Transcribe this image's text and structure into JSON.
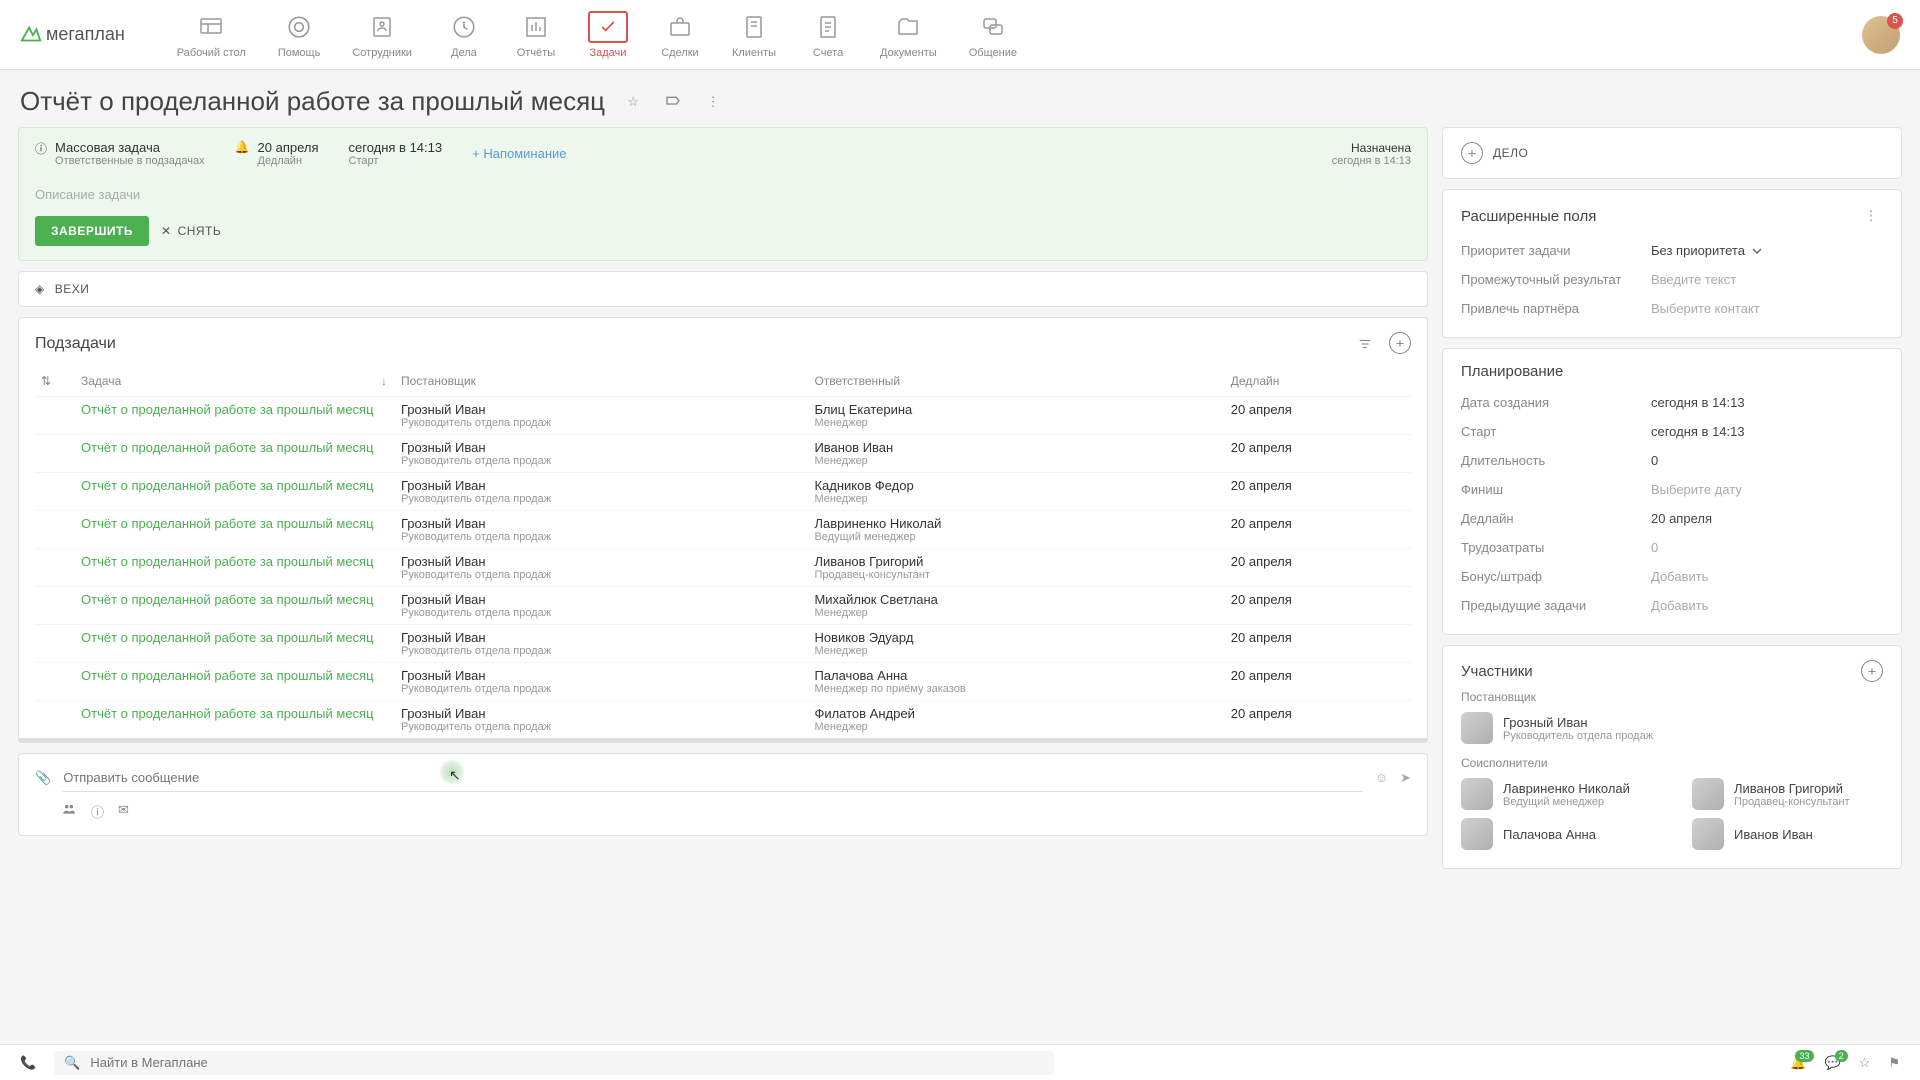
{
  "header": {
    "logo": "мегаплан",
    "avatar_badge": "5",
    "nav": [
      {
        "label": "Рабочий стол",
        "name": "nav-desktop"
      },
      {
        "label": "Помощь",
        "name": "nav-help"
      },
      {
        "label": "Сотрудники",
        "name": "nav-staff"
      },
      {
        "label": "Дела",
        "name": "nav-affairs"
      },
      {
        "label": "Отчёты",
        "name": "nav-reports"
      },
      {
        "label": "Задачи",
        "name": "nav-tasks",
        "active": true
      },
      {
        "label": "Сделки",
        "name": "nav-deals"
      },
      {
        "label": "Клиенты",
        "name": "nav-clients"
      },
      {
        "label": "Счета",
        "name": "nav-invoices"
      },
      {
        "label": "Документы",
        "name": "nav-docs"
      },
      {
        "label": "Общение",
        "name": "nav-chat"
      }
    ]
  },
  "title": "Отчёт о проделанной работе за прошлый месяц",
  "status": {
    "mass_task": "Массовая задача",
    "mass_sub": "Ответственные в подзадачах",
    "deadline_date": "20 апреля",
    "deadline_lbl": "Дедлайн",
    "start_date": "сегодня в 14:13",
    "start_lbl": "Старт",
    "reminder": "+ Напоминание",
    "assigned": "Назначена",
    "assigned_date": "сегодня в 14:13",
    "description_ph": "Описание задачи",
    "complete_btn": "ЗАВЕРШИТЬ",
    "remove_btn": "СНЯТЬ"
  },
  "milestones_label": "ВЕХИ",
  "subtasks": {
    "title": "Подзадачи",
    "columns": {
      "task": "Задача",
      "owner": "Постановщик",
      "assignee": "Ответственный",
      "deadline": "Дедлайн"
    },
    "rows": [
      {
        "task": "Отчёт о проделанной работе за прошлый месяц",
        "owner": "Грозный Иван",
        "owner_role": "Руководитель отдела продаж",
        "assignee": "Блиц Екатерина",
        "assignee_role": "Менеджер",
        "deadline": "20 апреля"
      },
      {
        "task": "Отчёт о проделанной работе за прошлый месяц",
        "owner": "Грозный Иван",
        "owner_role": "Руководитель отдела продаж",
        "assignee": "Иванов Иван",
        "assignee_role": "Менеджер",
        "deadline": "20 апреля"
      },
      {
        "task": "Отчёт о проделанной работе за прошлый месяц",
        "owner": "Грозный Иван",
        "owner_role": "Руководитель отдела продаж",
        "assignee": "Кадников Федор",
        "assignee_role": "Менеджер",
        "deadline": "20 апреля"
      },
      {
        "task": "Отчёт о проделанной работе за прошлый месяц",
        "owner": "Грозный Иван",
        "owner_role": "Руководитель отдела продаж",
        "assignee": "Лавриненко Николай",
        "assignee_role": "Ведущий менеджер",
        "deadline": "20 апреля"
      },
      {
        "task": "Отчёт о проделанной работе за прошлый месяц",
        "owner": "Грозный Иван",
        "owner_role": "Руководитель отдела продаж",
        "assignee": "Ливанов Григорий",
        "assignee_role": "Продавец-консультант",
        "deadline": "20 апреля"
      },
      {
        "task": "Отчёт о проделанной работе за прошлый месяц",
        "owner": "Грозный Иван",
        "owner_role": "Руководитель отдела продаж",
        "assignee": "Михайлюк Светлана",
        "assignee_role": "Менеджер",
        "deadline": "20 апреля"
      },
      {
        "task": "Отчёт о проделанной работе за прошлый месяц",
        "owner": "Грозный Иван",
        "owner_role": "Руководитель отдела продаж",
        "assignee": "Новиков Эдуард",
        "assignee_role": "Менеджер",
        "deadline": "20 апреля"
      },
      {
        "task": "Отчёт о проделанной работе за прошлый месяц",
        "owner": "Грозный Иван",
        "owner_role": "Руководитель отдела продаж",
        "assignee": "Палачова Анна",
        "assignee_role": "Менеджер по приёму заказов",
        "deadline": "20 апреля"
      },
      {
        "task": "Отчёт о проделанной работе за прошлый месяц",
        "owner": "Грозный Иван",
        "owner_role": "Руководитель отдела продаж",
        "assignee": "Филатов Андрей",
        "assignee_role": "Менеджер",
        "deadline": "20 апреля"
      }
    ]
  },
  "message": {
    "placeholder": "Отправить сообщение"
  },
  "side": {
    "case_label": "ДЕЛО",
    "ext_fields": {
      "title": "Расширенные поля",
      "priority_lbl": "Приоритет задачи",
      "priority_val": "Без приоритета",
      "interim_lbl": "Промежуточный результат",
      "interim_ph": "Введите текст",
      "partner_lbl": "Привлечь партнёра",
      "partner_ph": "Выберите контакт"
    },
    "planning": {
      "title": "Планирование",
      "created_lbl": "Дата создания",
      "created_val": "сегодня в 14:13",
      "start_lbl": "Старт",
      "start_val": "сегодня в 14:13",
      "duration_lbl": "Длительность",
      "duration_val": "0",
      "finish_lbl": "Финиш",
      "finish_ph": "Выберите дату",
      "deadline_lbl": "Дедлайн",
      "deadline_val": "20 апреля",
      "labor_lbl": "Трудозатраты",
      "labor_ph": "0",
      "bonus_lbl": "Бонус/штраф",
      "bonus_ph": "Добавить",
      "prev_lbl": "Предыдущие задачи",
      "prev_ph": "Добавить"
    },
    "participants": {
      "title": "Участники",
      "owner_lbl": "Постановщик",
      "owner": {
        "name": "Грозный Иван",
        "role": "Руководитель отдела продаж"
      },
      "co_lbl": "Соисполнители",
      "co": [
        {
          "name": "Лавриненко Николай",
          "role": "Ведущий менеджер"
        },
        {
          "name": "Ливанов Григорий",
          "role": "Продавец-консультант"
        },
        {
          "name": "Палачова Анна",
          "role": ""
        },
        {
          "name": "Иванов Иван",
          "role": ""
        }
      ]
    }
  },
  "footer": {
    "search_ph": "Найти в Мегаплане",
    "badge1": "33",
    "badge2": "2"
  }
}
